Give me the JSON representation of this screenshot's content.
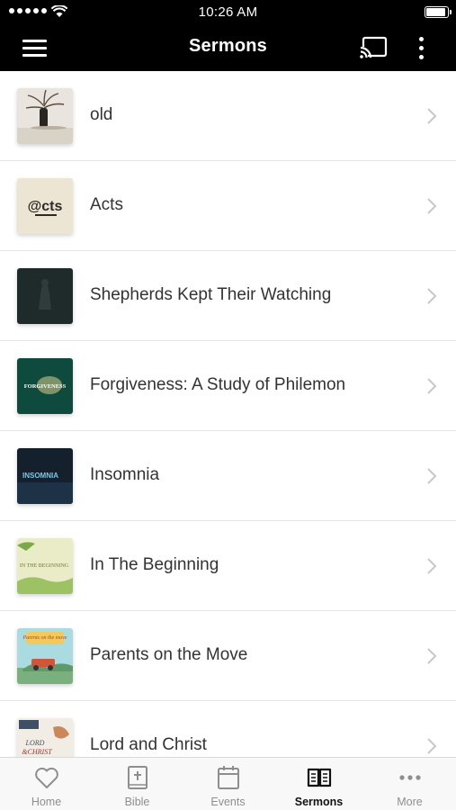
{
  "status_bar": {
    "time": "10:26 AM",
    "battery_level": 0.95,
    "signal_bars": 5
  },
  "nav": {
    "title": "Sermons",
    "menu_icon": "hamburger-icon",
    "cast_icon": "cast-icon",
    "more_icon": "vertical-ellipsis-icon"
  },
  "sermons": [
    {
      "title": "old",
      "thumb_text": ""
    },
    {
      "title": "Acts",
      "thumb_text": "@cts"
    },
    {
      "title": "Shepherds Kept Their Watching",
      "thumb_text": ""
    },
    {
      "title": "Forgiveness: A Study of Philemon",
      "thumb_text": "FORGIVENESS"
    },
    {
      "title": "Insomnia",
      "thumb_text": "INSOMNIA"
    },
    {
      "title": "In The Beginning",
      "thumb_text": "IN THE BEGINNING"
    },
    {
      "title": "Parents on the Move",
      "thumb_text": "Parents on the move"
    },
    {
      "title": "Lord and Christ",
      "thumb_text_1": "LORD",
      "thumb_text_2": "&CHRIST"
    }
  ],
  "tabs": [
    {
      "label": "Home",
      "icon": "heart-icon",
      "active": false
    },
    {
      "label": "Bible",
      "icon": "bible-icon",
      "active": false
    },
    {
      "label": "Events",
      "icon": "calendar-icon",
      "active": false
    },
    {
      "label": "Sermons",
      "icon": "open-book-icon",
      "active": true
    },
    {
      "label": "More",
      "icon": "horizontal-ellipsis-icon",
      "active": false
    }
  ],
  "colors": {
    "nav_background": "#000000",
    "active_tab": "#111111",
    "inactive_tab": "#8e8e8e"
  }
}
